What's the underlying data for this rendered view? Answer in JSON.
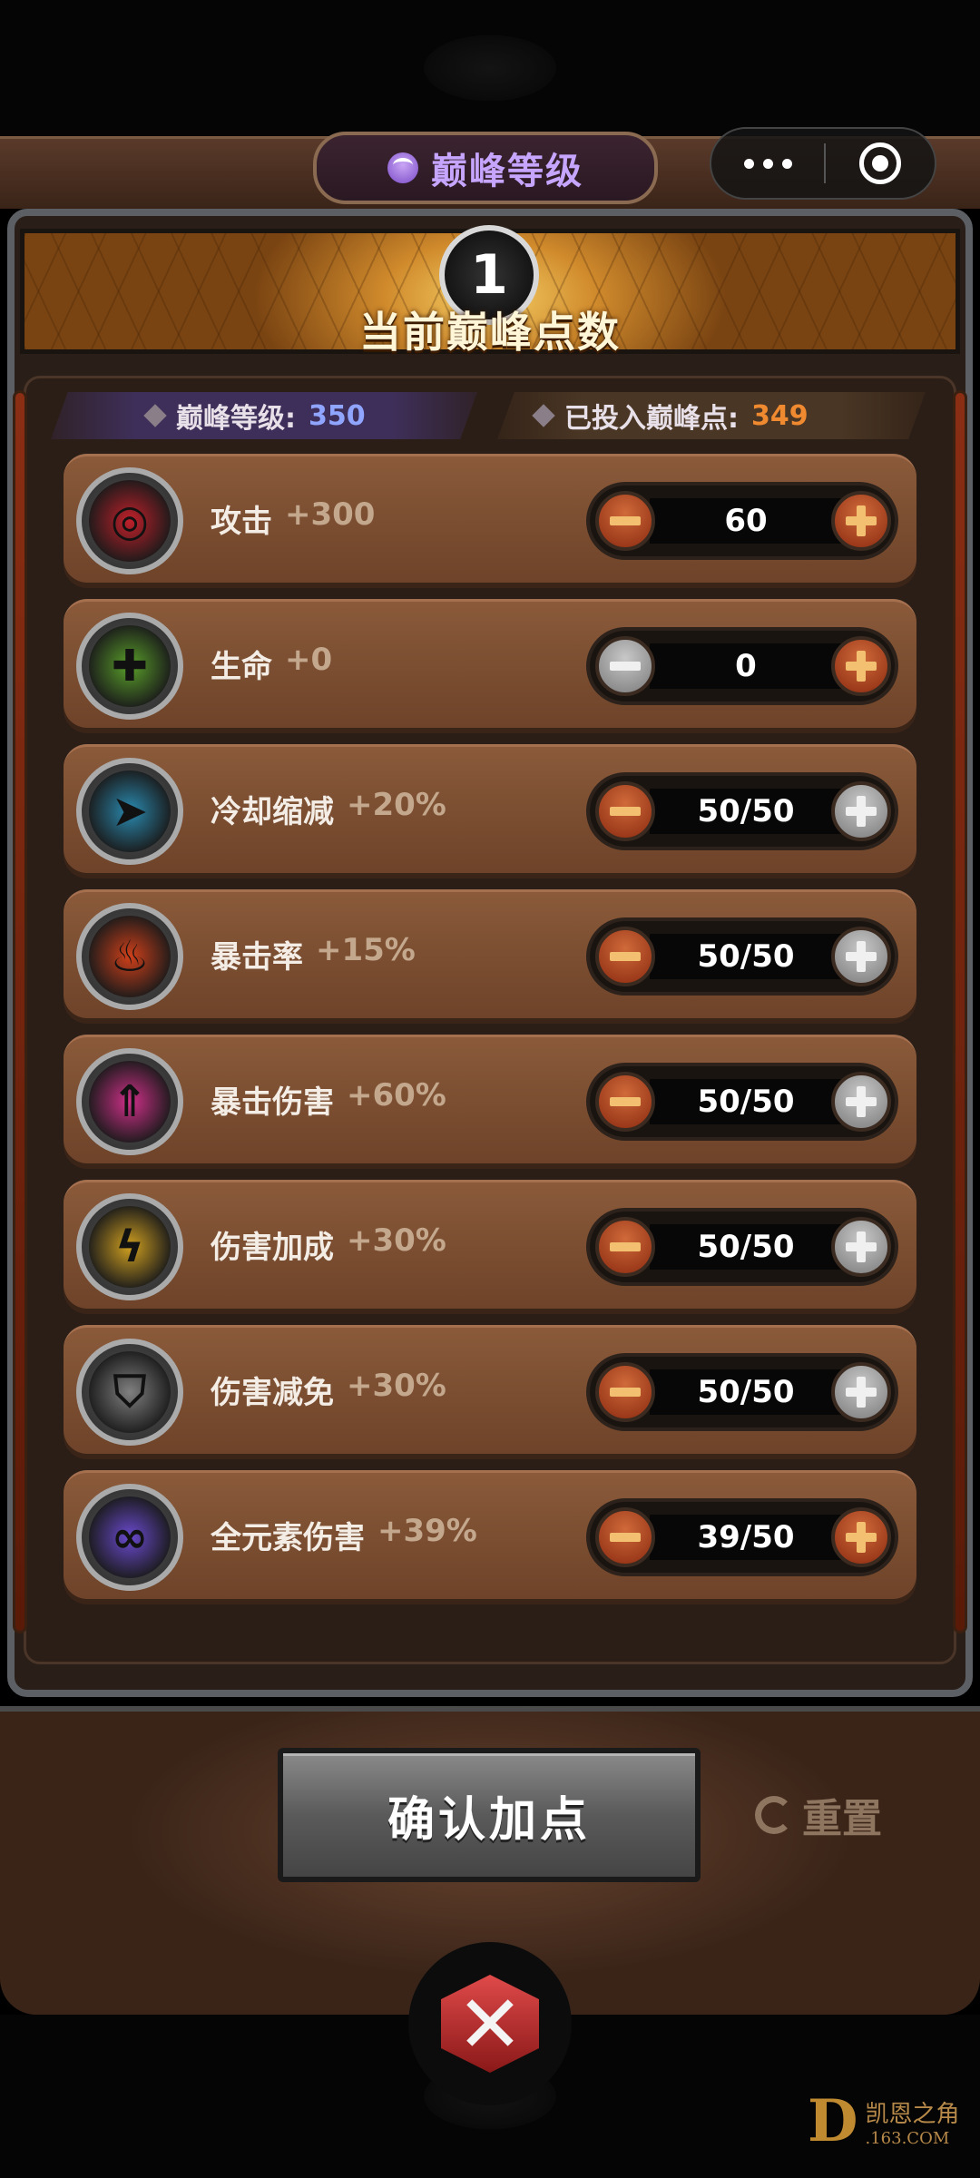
{
  "header": {
    "title": "巅峰等级",
    "capsule": {
      "more_icon": "more-dots-icon",
      "close_icon": "target-circle-icon"
    }
  },
  "banner": {
    "points": "1",
    "label": "当前巅峰点数"
  },
  "stats": {
    "level_label": "巅峰等级:",
    "level_value": "350",
    "invested_label": "已投入巅峰点:",
    "invested_value": "349"
  },
  "rows": [
    {
      "name": "攻击",
      "bonus": "+300",
      "value": "60",
      "icon": "target-attack-icon",
      "color": "#c0202a",
      "minus_enabled": true,
      "plus_enabled": true
    },
    {
      "name": "生命",
      "bonus": "+0",
      "value": "0",
      "icon": "health-cross-icon",
      "color": "#5aa02a",
      "minus_enabled": false,
      "plus_enabled": true
    },
    {
      "name": "冷却缩减",
      "bonus": "+20%",
      "value": "50/50",
      "icon": "cooldown-clock-icon",
      "color": "#2a8ab0",
      "minus_enabled": true,
      "plus_enabled": false
    },
    {
      "name": "暴击率",
      "bonus": "+15%",
      "value": "50/50",
      "icon": "crit-flame-icon",
      "color": "#d0401a",
      "minus_enabled": true,
      "plus_enabled": false
    },
    {
      "name": "暴击伤害",
      "bonus": "+60%",
      "value": "50/50",
      "icon": "crit-damage-arrow-icon",
      "color": "#d0308a",
      "minus_enabled": true,
      "plus_enabled": false
    },
    {
      "name": "伤害加成",
      "bonus": "+30%",
      "value": "50/50",
      "icon": "lightning-damage-icon",
      "color": "#d0a020",
      "minus_enabled": true,
      "plus_enabled": false
    },
    {
      "name": "伤害减免",
      "bonus": "+30%",
      "value": "50/50",
      "icon": "shield-reduction-icon",
      "color": "#808080",
      "minus_enabled": true,
      "plus_enabled": false
    },
    {
      "name": "全元素伤害",
      "bonus": "+39%",
      "value": "39/50",
      "icon": "elements-orbs-icon",
      "color": "#6a4ad0",
      "minus_enabled": true,
      "plus_enabled": true
    }
  ],
  "actions": {
    "confirm_label": "确认加点",
    "reset_label": "重置"
  },
  "watermark": {
    "logo": "D",
    "line1": "凯恩之角",
    "line2": ".163.COM"
  }
}
